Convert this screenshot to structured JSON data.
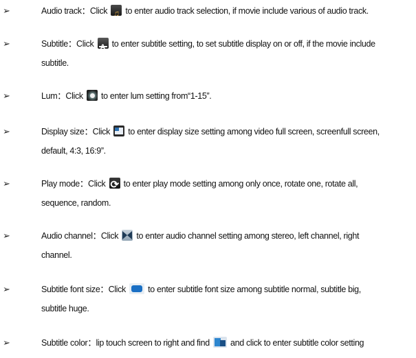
{
  "bullet_glyph": "➢",
  "icons": [
    "audio-track-icon",
    "subtitle-icon",
    "lum-icon",
    "display-size-icon",
    "play-mode-icon",
    "audio-channel-icon",
    "subtitle-font-size-icon",
    "subtitle-color-icon"
  ],
  "items": [
    {
      "pre": "Audio track：Click ",
      "post": " to enter audio track selection, if movie include various of audio track.",
      "cont": ""
    },
    {
      "pre": "Subtitle：Click ",
      "post": " to enter subtitle setting, to set subtitle display on or off, if the movie include",
      "cont": "subtitle."
    },
    {
      "pre": "Lum：Click ",
      "post": " to enter lum setting from“1-15”.",
      "cont": ""
    },
    {
      "pre": "Display size：Click ",
      "post": " to enter display size setting among video full screen, screenfull screen,",
      "cont": "default, 4:3, 16:9”."
    },
    {
      "pre": "Play mode：Click ",
      "post": " to enter play mode setting among only once, rotate one, rotate all,",
      "cont": "sequence, random."
    },
    {
      "pre": "Audio channel：Click ",
      "post": " to enter audio channel setting among stereo, left channel, right",
      "cont": "channel."
    },
    {
      "pre": "Subtitle font size：Click ",
      "post": " to enter subtitle font size among subtitle normal, subtitle big,",
      "cont": "subtitle huge."
    },
    {
      "pre": "Subtitle color：lip touch screen to right and find ",
      "post": " and click to enter subtitle color setting",
      "cont": ""
    }
  ]
}
